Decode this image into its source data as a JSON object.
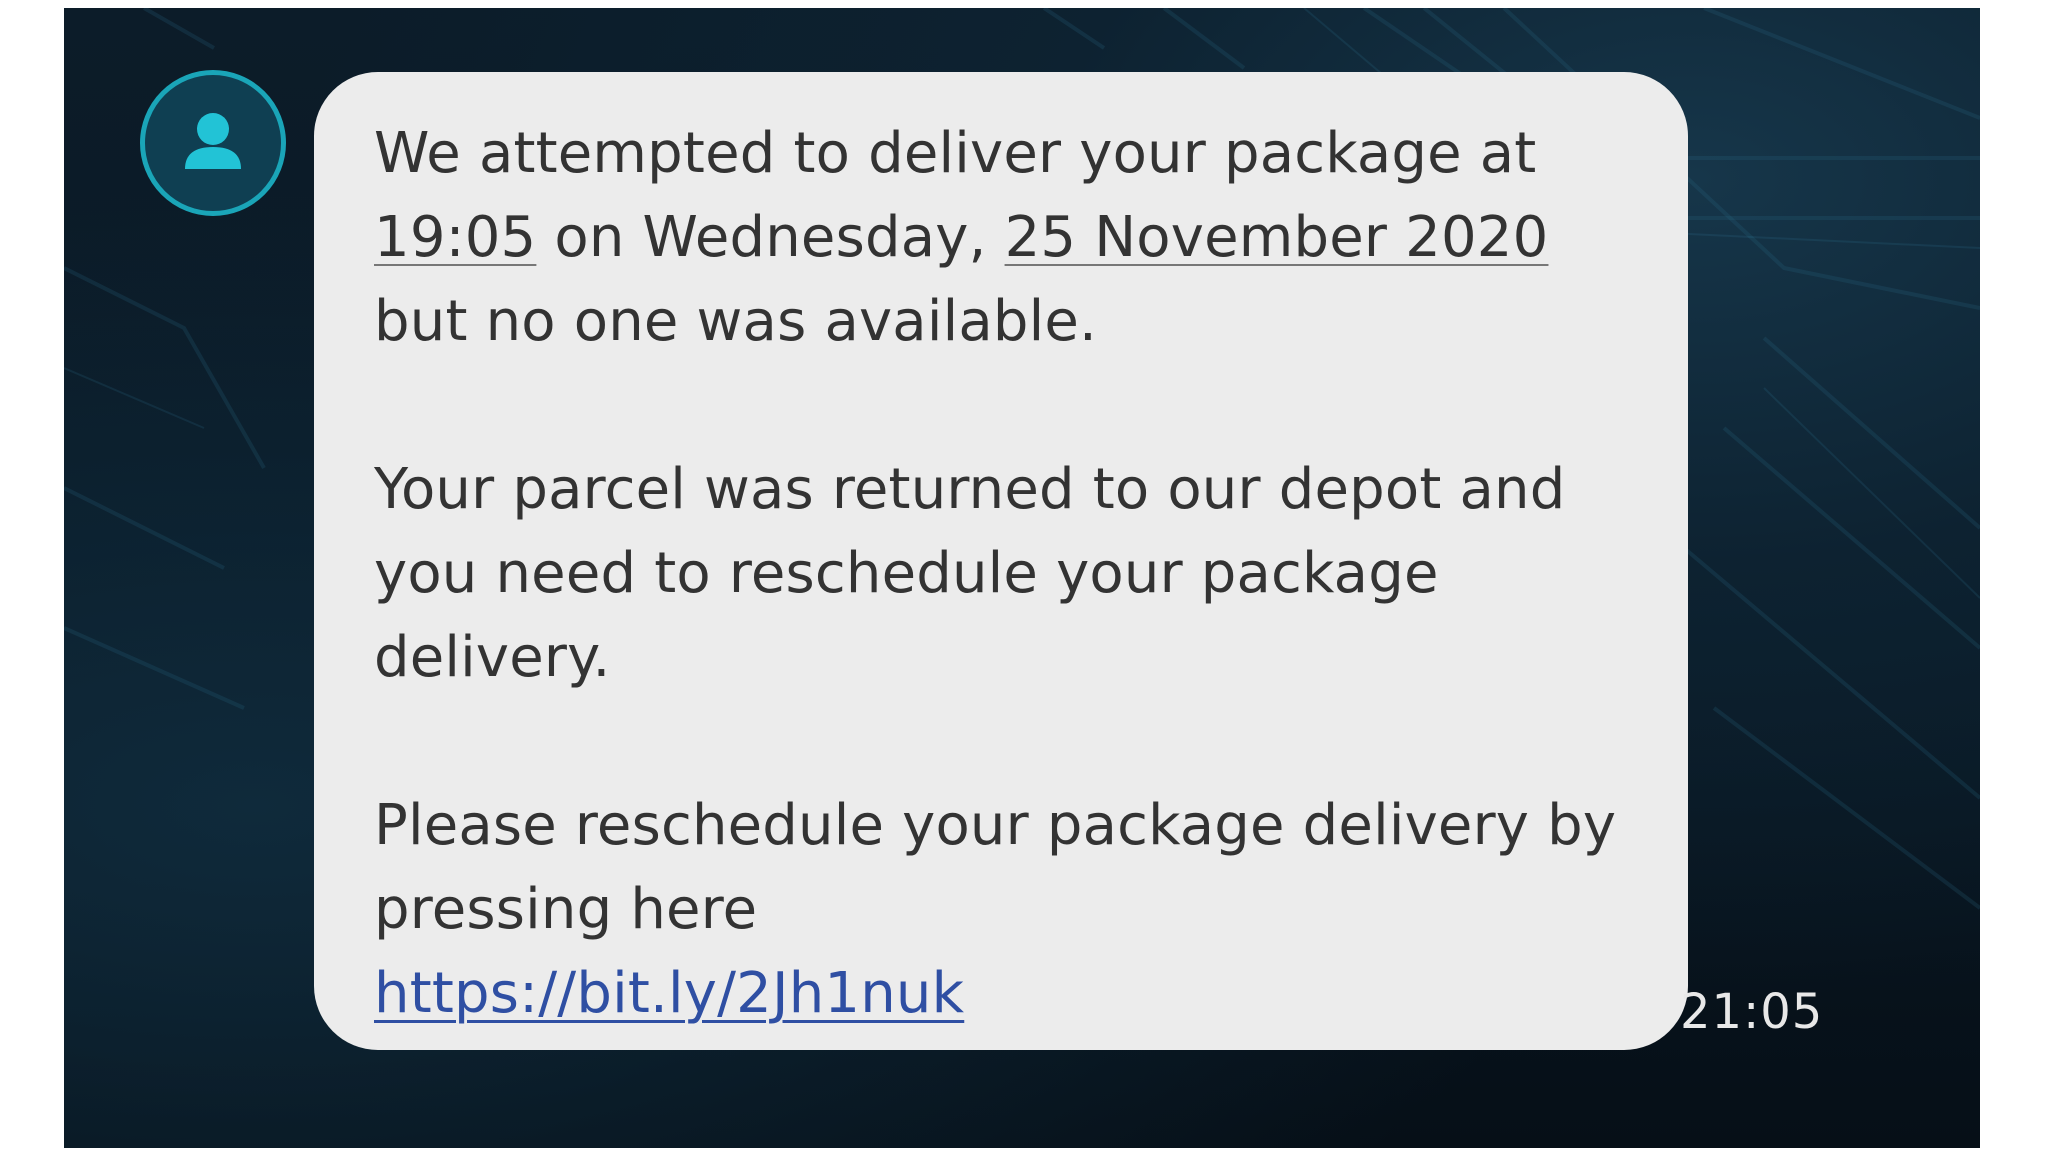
{
  "message": {
    "p1": {
      "before_time": "We attempted to deliver your package at ",
      "time": "19:05",
      "mid": " on Wednesday, ",
      "date": "25 November 2020",
      "after": " but no one was available."
    },
    "p2": "Your parcel was returned to our depot and you need to reschedule your package delivery.",
    "p3": {
      "text": "Please reschedule your package delivery by pressing here",
      "link": "https://bit.ly/2Jh1nuk"
    },
    "timestamp": "21:05"
  },
  "sender": {
    "avatar_icon": "person-icon"
  },
  "colors": {
    "bubble": "#ececec",
    "link": "#2f4fa3",
    "avatar_ring": "#1aa5b8",
    "background": "#0b1a26"
  }
}
